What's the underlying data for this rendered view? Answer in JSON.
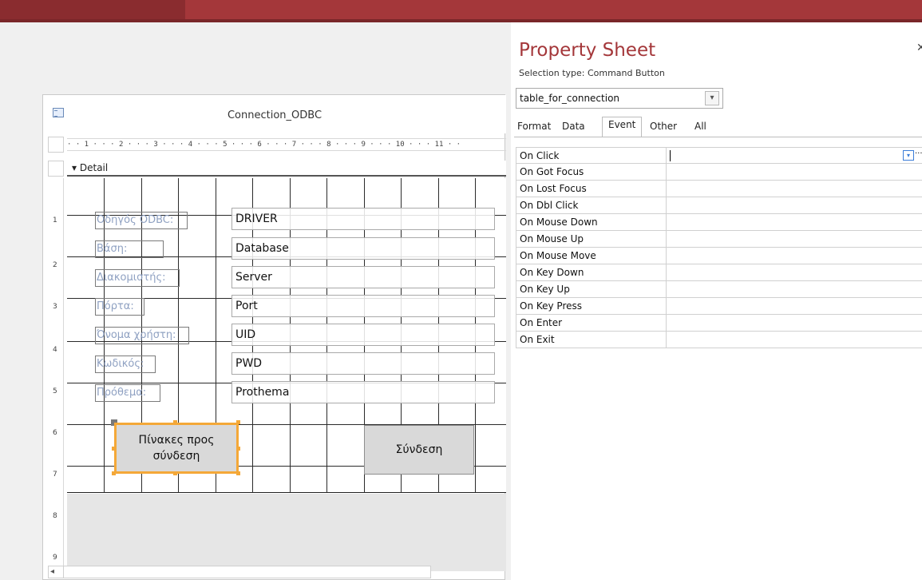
{
  "app": {
    "title_bar_color": "#a4373a"
  },
  "form": {
    "title": "Connection_ODBC",
    "ruler_text": "· · 1 · · · 2 · · · 3 · · · 4 · · · 5 · · · 6 · · · 7 · · · 8 · · · 9 · · · 10 · · · 11 · ·",
    "vruler_ticks": [
      "1",
      "2",
      "3",
      "4",
      "5",
      "6",
      "7",
      "8",
      "9"
    ],
    "detail_section": "Detail",
    "fields": [
      {
        "label": "Οδηγός ODBC:",
        "value": "DRIVER"
      },
      {
        "label": "Βάση:",
        "value": "Database"
      },
      {
        "label": "Διακομιστής:",
        "value": "Server"
      },
      {
        "label": "Πόρτα:",
        "value": "Port"
      },
      {
        "label": "Όνομα χρήστη:",
        "value": "UID"
      },
      {
        "label": "Κωδικός:",
        "value": "PWD"
      },
      {
        "label": "Πρόθεμα:",
        "value": "Prothema"
      }
    ],
    "buttons": {
      "tables": "Πίνακες προς σύνδεση",
      "connect": "Σύνδεση"
    }
  },
  "property_sheet": {
    "title": "Property Sheet",
    "selection_type": "Selection type:  Command Button",
    "selected_object": "table_for_connection",
    "tabs": [
      "Format",
      "Data",
      "Event",
      "Other",
      "All"
    ],
    "active_tab": "Event",
    "properties": [
      "On Click",
      "On Got Focus",
      "On Lost Focus",
      "On Dbl Click",
      "On Mouse Down",
      "On Mouse Up",
      "On Mouse Move",
      "On Key Down",
      "On Key Up",
      "On Key Press",
      "On Enter",
      "On Exit"
    ]
  }
}
